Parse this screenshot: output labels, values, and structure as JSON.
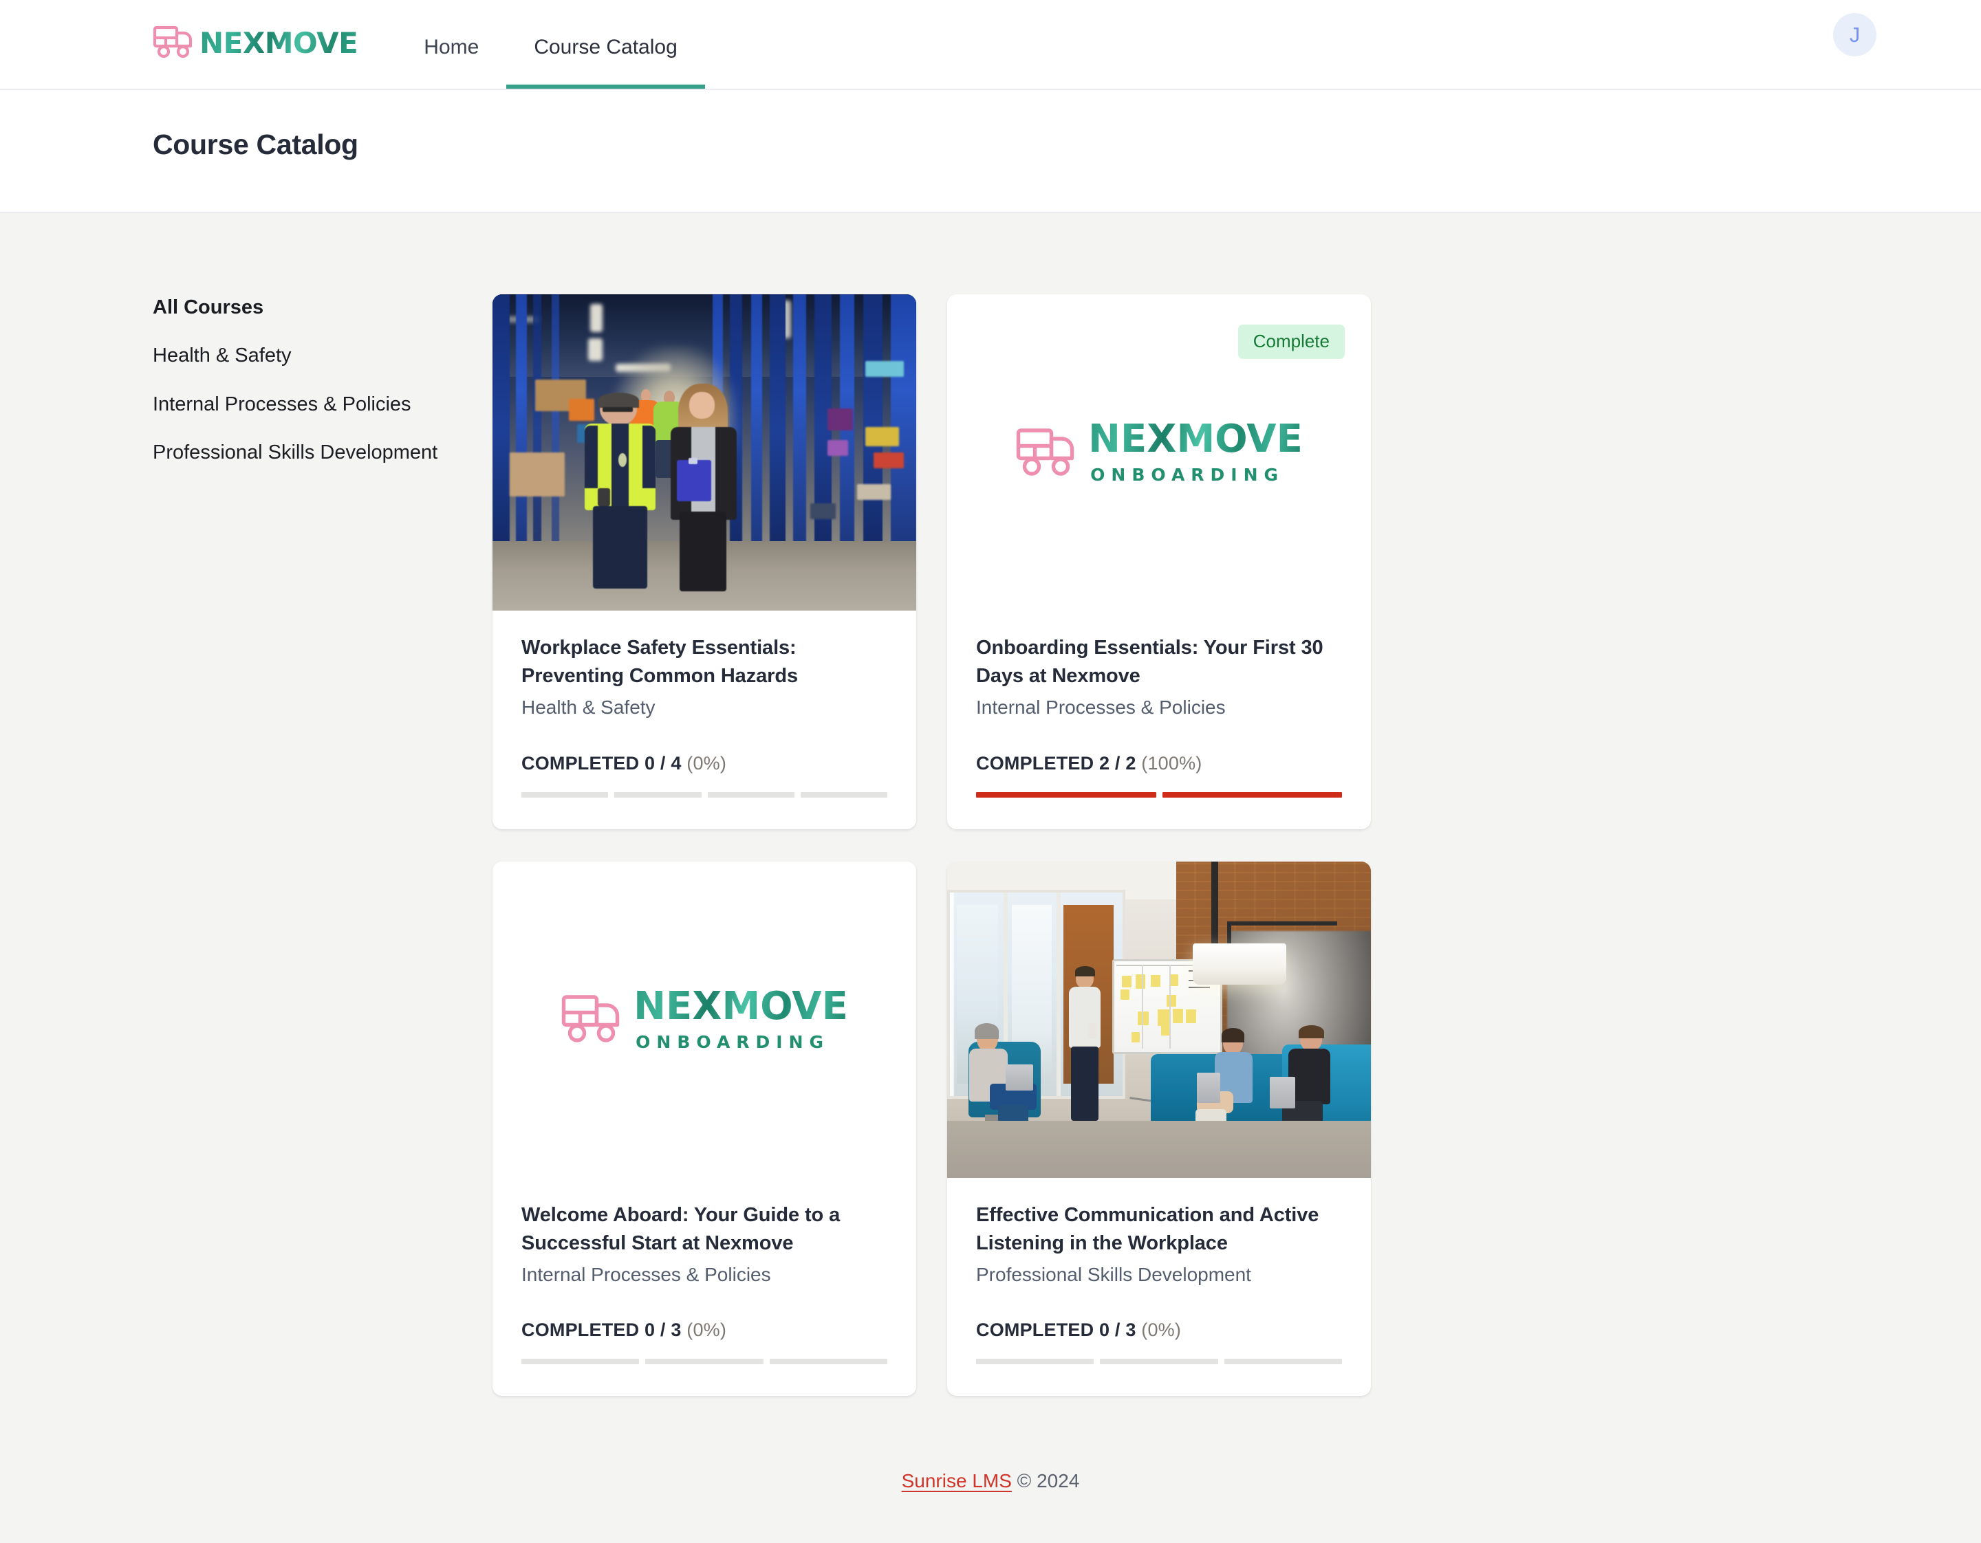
{
  "brand": {
    "name": "NEXMOVE",
    "truck_icon": "truck-icon"
  },
  "nav": {
    "items": [
      {
        "label": "Home",
        "active": false
      },
      {
        "label": "Course Catalog",
        "active": true
      }
    ],
    "avatar_initial": "J"
  },
  "page": {
    "title": "Course Catalog"
  },
  "sidebar": {
    "filters": [
      {
        "label": "All Courses",
        "active": true
      },
      {
        "label": "Health & Safety",
        "active": false
      },
      {
        "label": "Internal Processes & Policies",
        "active": false
      },
      {
        "label": "Professional Skills Development",
        "active": false
      }
    ]
  },
  "onboarding_logo": {
    "name": "NEXMOVE",
    "subtitle": "ONBOARDING"
  },
  "courses": [
    {
      "title": "Workplace Safety Essentials: Preventing Common Hazards",
      "category": "Health & Safety",
      "completed_label": "COMPLETED 0 / 4",
      "percent_label": "(0%)",
      "completed": 0,
      "total": 4,
      "percent": 0,
      "badge": null,
      "media": "photo-warehouse"
    },
    {
      "title": "Onboarding Essentials: Your First 30 Days at Nexmove",
      "category": "Internal Processes & Policies",
      "completed_label": "COMPLETED 2 / 2",
      "percent_label": "(100%)",
      "completed": 2,
      "total": 2,
      "percent": 100,
      "badge": "Complete",
      "media": "logo-onboarding"
    },
    {
      "title": "Welcome Aboard: Your Guide to a Successful Start at Nexmove",
      "category": "Internal Processes & Policies",
      "completed_label": "COMPLETED 0 / 3",
      "percent_label": "(0%)",
      "completed": 0,
      "total": 3,
      "percent": 0,
      "badge": null,
      "media": "logo-onboarding"
    },
    {
      "title": "Effective Communication and Active Listening in the Workplace",
      "category": "Professional Skills Development",
      "completed_label": "COMPLETED 0 / 3",
      "percent_label": "(0%)",
      "completed": 0,
      "total": 3,
      "percent": 0,
      "badge": null,
      "media": "photo-office"
    }
  ],
  "footer": {
    "link_label": "Sunrise LMS",
    "copyright": " © 2024"
  },
  "colors": {
    "brand_teal": "#2e9c82",
    "brand_pink": "#ef8fb0",
    "accent_red": "#cf2d19",
    "badge_bg": "#d6f5e0",
    "badge_text": "#157a35",
    "page_bg": "#f4f4f2",
    "avatar_bg": "#e8effb",
    "avatar_text": "#7a93ef",
    "link_red": "#d0352a"
  }
}
